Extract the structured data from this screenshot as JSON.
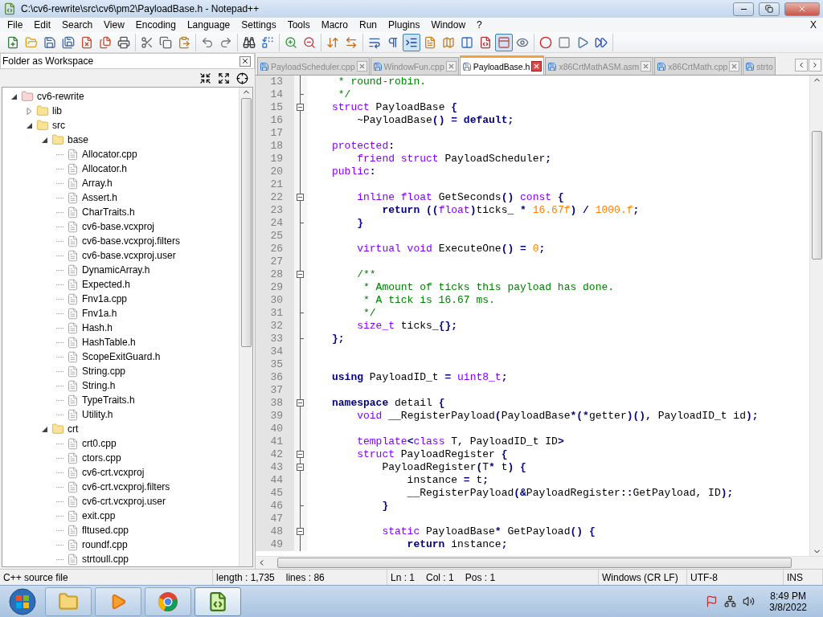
{
  "window": {
    "title": "C:\\cv6-rewrite\\src\\cv6\\pm2\\PayloadBase.h - Notepad++"
  },
  "menu": [
    "File",
    "Edit",
    "Search",
    "View",
    "Encoding",
    "Language",
    "Settings",
    "Tools",
    "Macro",
    "Run",
    "Plugins",
    "Window",
    "?"
  ],
  "close_document": "X",
  "toolbar": [
    [
      {
        "kind": "new",
        "pressed": false
      },
      {
        "kind": "open",
        "pressed": false
      },
      {
        "kind": "save",
        "pressed": false
      },
      {
        "kind": "saveall",
        "pressed": false
      },
      {
        "kind": "close",
        "pressed": false
      },
      {
        "kind": "closeall",
        "pressed": false
      },
      {
        "kind": "print",
        "pressed": false
      }
    ],
    [
      {
        "kind": "cut",
        "pressed": false
      },
      {
        "kind": "copy",
        "pressed": false
      },
      {
        "kind": "paste",
        "pressed": false
      }
    ],
    [
      {
        "kind": "undo",
        "pressed": false
      },
      {
        "kind": "redo",
        "pressed": false
      }
    ],
    [
      {
        "kind": "find",
        "pressed": false
      },
      {
        "kind": "replace",
        "pressed": false
      }
    ],
    [
      {
        "kind": "zoomin",
        "pressed": false
      },
      {
        "kind": "zoomout",
        "pressed": false
      }
    ],
    [
      {
        "kind": "syncv",
        "pressed": false
      },
      {
        "kind": "synch",
        "pressed": false
      }
    ],
    [
      {
        "kind": "wrap",
        "pressed": false
      },
      {
        "kind": "allchars",
        "pressed": false
      },
      {
        "kind": "indent",
        "pressed": true
      },
      {
        "kind": "doc",
        "pressed": false
      },
      {
        "kind": "map",
        "pressed": false
      },
      {
        "kind": "columns",
        "pressed": false
      },
      {
        "kind": "func",
        "pressed": false
      },
      {
        "kind": "panel",
        "pressed": true
      },
      {
        "kind": "monitor",
        "pressed": false
      }
    ],
    [
      {
        "kind": "record",
        "pressed": false
      },
      {
        "kind": "stop",
        "pressed": false
      },
      {
        "kind": "play",
        "pressed": false
      },
      {
        "kind": "playmulti",
        "pressed": false
      }
    ]
  ],
  "sidebar": {
    "title": "Folder as Workspace",
    "tree": [
      {
        "label": "cv6-rewrite",
        "kind": "project",
        "expanded": true,
        "children": [
          {
            "label": "lib",
            "kind": "folder",
            "expanded": false
          },
          {
            "label": "src",
            "kind": "folder",
            "expanded": true,
            "children": [
              {
                "label": "base",
                "kind": "folder",
                "expanded": true,
                "children": [
                  {
                    "label": "Allocator.cpp",
                    "kind": "file"
                  },
                  {
                    "label": "Allocator.h",
                    "kind": "file"
                  },
                  {
                    "label": "Array.h",
                    "kind": "file"
                  },
                  {
                    "label": "Assert.h",
                    "kind": "file"
                  },
                  {
                    "label": "CharTraits.h",
                    "kind": "file"
                  },
                  {
                    "label": "cv6-base.vcxproj",
                    "kind": "file"
                  },
                  {
                    "label": "cv6-base.vcxproj.filters",
                    "kind": "file"
                  },
                  {
                    "label": "cv6-base.vcxproj.user",
                    "kind": "file"
                  },
                  {
                    "label": "DynamicArray.h",
                    "kind": "file"
                  },
                  {
                    "label": "Expected.h",
                    "kind": "file"
                  },
                  {
                    "label": "Fnv1a.cpp",
                    "kind": "file"
                  },
                  {
                    "label": "Fnv1a.h",
                    "kind": "file"
                  },
                  {
                    "label": "Hash.h",
                    "kind": "file"
                  },
                  {
                    "label": "HashTable.h",
                    "kind": "file"
                  },
                  {
                    "label": "ScopeExitGuard.h",
                    "kind": "file"
                  },
                  {
                    "label": "String.cpp",
                    "kind": "file"
                  },
                  {
                    "label": "String.h",
                    "kind": "file"
                  },
                  {
                    "label": "TypeTraits.h",
                    "kind": "file"
                  },
                  {
                    "label": "Utility.h",
                    "kind": "file"
                  }
                ]
              },
              {
                "label": "crt",
                "kind": "folder",
                "expanded": true,
                "children": [
                  {
                    "label": "crt0.cpp",
                    "kind": "file"
                  },
                  {
                    "label": "ctors.cpp",
                    "kind": "file"
                  },
                  {
                    "label": "cv6-crt.vcxproj",
                    "kind": "file"
                  },
                  {
                    "label": "cv6-crt.vcxproj.filters",
                    "kind": "file"
                  },
                  {
                    "label": "cv6-crt.vcxproj.user",
                    "kind": "file"
                  },
                  {
                    "label": "exit.cpp",
                    "kind": "file"
                  },
                  {
                    "label": "fltused.cpp",
                    "kind": "file"
                  },
                  {
                    "label": "roundf.cpp",
                    "kind": "file"
                  },
                  {
                    "label": "strtoull.cpp",
                    "kind": "file"
                  }
                ]
              }
            ]
          }
        ]
      }
    ]
  },
  "tabs": [
    {
      "label": "PayloadScheduler.cpp",
      "selected": false
    },
    {
      "label": "WindowFun.cpp",
      "selected": false
    },
    {
      "label": "PayloadBase.h",
      "selected": true
    },
    {
      "label": "x86CrtMathASM.asm",
      "selected": false
    },
    {
      "label": "x86CrtMath.cpp",
      "selected": false
    },
    {
      "label": "strto",
      "selected": false
    }
  ],
  "code": [
    {
      "number": "13",
      "fold_open": false,
      "fold_end": false,
      "tokens": [
        {
          "kind": "comment",
          "text": " * round-robin."
        }
      ]
    },
    {
      "number": "14",
      "fold_open": false,
      "fold_end": true,
      "tokens": [
        {
          "kind": "comment",
          "text": " */"
        }
      ]
    },
    {
      "number": "15",
      "fold_open": true,
      "fold_end": false,
      "tokens": [
        {
          "kind": "type",
          "text": "struct"
        },
        {
          "kind": "plain",
          "text": " PayloadBase"
        },
        {
          "kind": "operator",
          "text": " {"
        }
      ]
    },
    {
      "number": "16",
      "fold_open": false,
      "fold_end": false,
      "tokens": [
        {
          "kind": "plain",
          "text": "    ~PayloadBase"
        },
        {
          "kind": "operator",
          "text": "() = "
        },
        {
          "kind": "keyword",
          "text": "default"
        },
        {
          "kind": "operator",
          "text": ";"
        }
      ]
    },
    {
      "number": "17",
      "fold_open": false,
      "fold_end": false
    },
    {
      "number": "18",
      "fold_open": false,
      "fold_end": false,
      "tokens": [
        {
          "kind": "type",
          "text": "protected"
        },
        {
          "kind": "operator",
          "text": ":"
        }
      ]
    },
    {
      "number": "19",
      "fold_open": false,
      "fold_end": false,
      "tokens": [
        {
          "kind": "type",
          "text": "    friend struct"
        },
        {
          "kind": "plain",
          "text": " PayloadScheduler"
        },
        {
          "kind": "operator",
          "text": ";"
        }
      ]
    },
    {
      "number": "20",
      "fold_open": false,
      "fold_end": false,
      "tokens": [
        {
          "kind": "type",
          "text": "public"
        },
        {
          "kind": "operator",
          "text": ":"
        }
      ]
    },
    {
      "number": "21",
      "fold_open": false,
      "fold_end": false
    },
    {
      "number": "22",
      "fold_open": true,
      "fold_end": false,
      "tokens": [
        {
          "kind": "type",
          "text": "    inline float"
        },
        {
          "kind": "plain",
          "text": " GetSeconds"
        },
        {
          "kind": "operator",
          "text": "() "
        },
        {
          "kind": "type",
          "text": "const"
        },
        {
          "kind": "operator",
          "text": " {"
        }
      ]
    },
    {
      "number": "23",
      "fold_open": false,
      "fold_end": false,
      "tokens": [
        {
          "kind": "keyword",
          "text": "        return"
        },
        {
          "kind": "operator",
          "text": " (("
        },
        {
          "kind": "type",
          "text": "float"
        },
        {
          "kind": "operator",
          "text": ")"
        },
        {
          "kind": "plain",
          "text": "ticks_"
        },
        {
          "kind": "operator",
          "text": " * "
        },
        {
          "kind": "number",
          "text": "16.67f"
        },
        {
          "kind": "operator",
          "text": ") / "
        },
        {
          "kind": "number",
          "text": "1000.f"
        },
        {
          "kind": "operator",
          "text": ";"
        }
      ]
    },
    {
      "number": "24",
      "fold_open": false,
      "fold_end": true,
      "tokens": [
        {
          "kind": "operator",
          "text": "    }"
        }
      ]
    },
    {
      "number": "25",
      "fold_open": false,
      "fold_end": false
    },
    {
      "number": "26",
      "fold_open": false,
      "fold_end": false,
      "tokens": [
        {
          "kind": "type",
          "text": "    virtual void"
        },
        {
          "kind": "plain",
          "text": " ExecuteOne"
        },
        {
          "kind": "operator",
          "text": "() = "
        },
        {
          "kind": "number",
          "text": "0"
        },
        {
          "kind": "operator",
          "text": ";"
        }
      ]
    },
    {
      "number": "27",
      "fold_open": false,
      "fold_end": false
    },
    {
      "number": "28",
      "fold_open": true,
      "fold_end": false,
      "tokens": [
        {
          "kind": "comment",
          "text": "    /**"
        }
      ]
    },
    {
      "number": "29",
      "fold_open": false,
      "fold_end": false,
      "tokens": [
        {
          "kind": "comment",
          "text": "     * Amount of ticks this payload has done."
        }
      ]
    },
    {
      "number": "30",
      "fold_open": false,
      "fold_end": false,
      "tokens": [
        {
          "kind": "comment",
          "text": "     * A tick is 16.67 ms."
        }
      ]
    },
    {
      "number": "31",
      "fold_open": false,
      "fold_end": true,
      "tokens": [
        {
          "kind": "comment",
          "text": "     */"
        }
      ]
    },
    {
      "number": "32",
      "fold_open": false,
      "fold_end": false,
      "tokens": [
        {
          "kind": "type",
          "text": "    size_t"
        },
        {
          "kind": "plain",
          "text": " ticks_"
        },
        {
          "kind": "operator",
          "text": "{};"
        }
      ]
    },
    {
      "number": "33",
      "fold_open": false,
      "fold_end": true,
      "tokens": [
        {
          "kind": "operator",
          "text": "};"
        }
      ]
    },
    {
      "number": "34",
      "fold_open": false,
      "fold_end": false
    },
    {
      "number": "35",
      "fold_open": false,
      "fold_end": false
    },
    {
      "number": "36",
      "fold_open": false,
      "fold_end": false,
      "tokens": [
        {
          "kind": "keyword",
          "text": "using"
        },
        {
          "kind": "plain",
          "text": " PayloadID_t"
        },
        {
          "kind": "operator",
          "text": " = "
        },
        {
          "kind": "type",
          "text": "uint8_t"
        },
        {
          "kind": "operator",
          "text": ";"
        }
      ]
    },
    {
      "number": "37",
      "fold_open": false,
      "fold_end": false
    },
    {
      "number": "38",
      "fold_open": true,
      "fold_end": false,
      "tokens": [
        {
          "kind": "keyword",
          "text": "namespace"
        },
        {
          "kind": "plain",
          "text": " detail"
        },
        {
          "kind": "operator",
          "text": " {"
        }
      ]
    },
    {
      "number": "39",
      "fold_open": false,
      "fold_end": false,
      "tokens": [
        {
          "kind": "type",
          "text": "    void"
        },
        {
          "kind": "plain",
          "text": " __RegisterPayload"
        },
        {
          "kind": "operator",
          "text": "("
        },
        {
          "kind": "plain",
          "text": "PayloadBase"
        },
        {
          "kind": "operator",
          "text": "*(*"
        },
        {
          "kind": "plain",
          "text": "getter"
        },
        {
          "kind": "operator",
          "text": ")(),"
        },
        {
          "kind": "plain",
          "text": " PayloadID_t id"
        },
        {
          "kind": "operator",
          "text": ");"
        }
      ]
    },
    {
      "number": "40",
      "fold_open": false,
      "fold_end": false
    },
    {
      "number": "41",
      "fold_open": false,
      "fold_end": false,
      "tokens": [
        {
          "kind": "type",
          "text": "    template"
        },
        {
          "kind": "operator",
          "text": "<"
        },
        {
          "kind": "type",
          "text": "class"
        },
        {
          "kind": "plain",
          "text": " T, PayloadID_t ID"
        },
        {
          "kind": "operator",
          "text": ">"
        }
      ]
    },
    {
      "number": "42",
      "fold_open": true,
      "fold_end": false,
      "tokens": [
        {
          "kind": "type",
          "text": "    struct"
        },
        {
          "kind": "plain",
          "text": " PayloadRegister"
        },
        {
          "kind": "operator",
          "text": " {"
        }
      ]
    },
    {
      "number": "43",
      "fold_open": true,
      "fold_end": false,
      "tokens": [
        {
          "kind": "plain",
          "text": "        PayloadRegister"
        },
        {
          "kind": "operator",
          "text": "("
        },
        {
          "kind": "plain",
          "text": "T"
        },
        {
          "kind": "operator",
          "text": "*"
        },
        {
          "kind": "plain",
          "text": " t"
        },
        {
          "kind": "operator",
          "text": ") {"
        }
      ]
    },
    {
      "number": "44",
      "fold_open": false,
      "fold_end": false,
      "tokens": [
        {
          "kind": "plain",
          "text": "            instance"
        },
        {
          "kind": "operator",
          "text": " = "
        },
        {
          "kind": "plain",
          "text": "t"
        },
        {
          "kind": "operator",
          "text": ";"
        }
      ]
    },
    {
      "number": "45",
      "fold_open": false,
      "fold_end": false,
      "tokens": [
        {
          "kind": "plain",
          "text": "            __RegisterPayload"
        },
        {
          "kind": "operator",
          "text": "(&"
        },
        {
          "kind": "plain",
          "text": "PayloadRegister"
        },
        {
          "kind": "operator",
          "text": "::"
        },
        {
          "kind": "plain",
          "text": "GetPayload, ID"
        },
        {
          "kind": "operator",
          "text": ");"
        }
      ]
    },
    {
      "number": "46",
      "fold_open": false,
      "fold_end": true,
      "tokens": [
        {
          "kind": "operator",
          "text": "        }"
        }
      ]
    },
    {
      "number": "47",
      "fold_open": false,
      "fold_end": false
    },
    {
      "number": "48",
      "fold_open": true,
      "fold_end": false,
      "tokens": [
        {
          "kind": "type",
          "text": "        static"
        },
        {
          "kind": "plain",
          "text": " PayloadBase"
        },
        {
          "kind": "operator",
          "text": "*"
        },
        {
          "kind": "plain",
          "text": " GetPayload"
        },
        {
          "kind": "operator",
          "text": "() {"
        }
      ]
    },
    {
      "number": "49",
      "fold_open": false,
      "fold_end": false,
      "tokens": [
        {
          "kind": "keyword",
          "text": "            return"
        },
        {
          "kind": "plain",
          "text": " instance"
        },
        {
          "kind": "operator",
          "text": ";"
        }
      ]
    }
  ],
  "status_bar": [
    {
      "texts": [
        "C++ source file"
      ]
    },
    {
      "texts": [
        "length : 1,735",
        "lines : 86"
      ]
    },
    {
      "texts": [
        "Ln : 1",
        "Col : 1",
        "Pos : 1"
      ]
    },
    {
      "texts": [
        "Windows (CR LF)"
      ]
    },
    {
      "texts": [
        "UTF-8"
      ]
    },
    {
      "texts": [
        "INS"
      ]
    }
  ],
  "taskbar": {
    "apps": [
      {
        "kind": "explorer",
        "active": false
      },
      {
        "kind": "media",
        "active": false
      },
      {
        "kind": "browser",
        "active": false
      },
      {
        "kind": "notepad",
        "active": true
      }
    ],
    "time": "8:49 PM",
    "date": "3/8/2022"
  }
}
